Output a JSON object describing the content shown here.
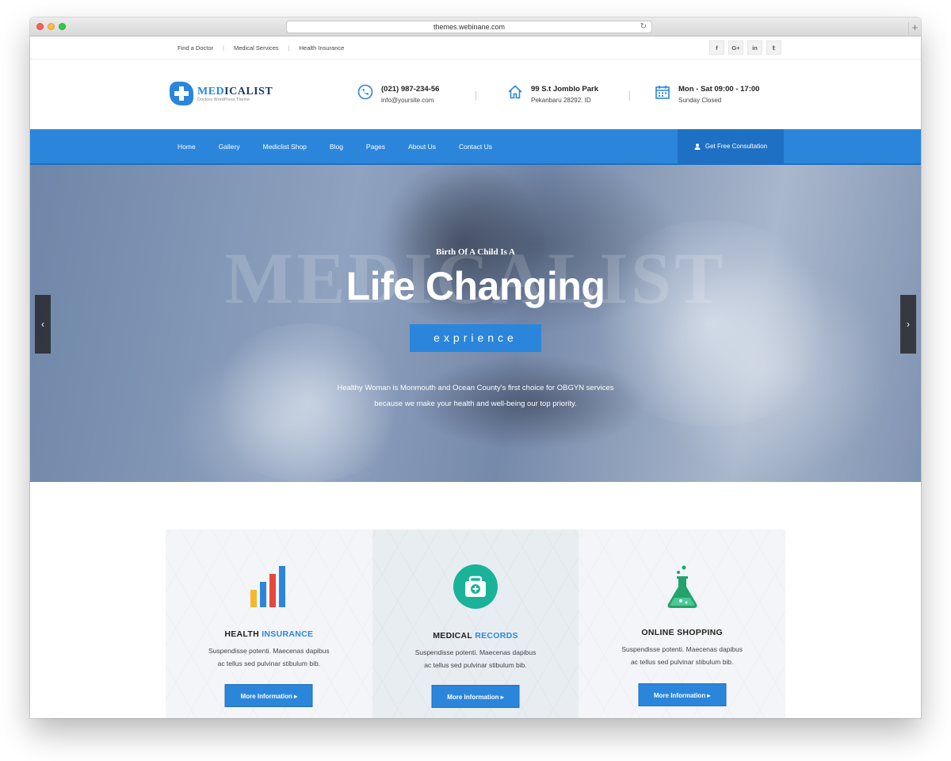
{
  "browser": {
    "url": "themes.webinane.com",
    "reload_icon": "↻",
    "newtab_icon": "+"
  },
  "topbar": {
    "links": [
      "Find a Doctor",
      "Medical Services",
      "Health Insurance"
    ],
    "separator": "|",
    "social": [
      {
        "name": "facebook-icon",
        "glyph": "f"
      },
      {
        "name": "google-plus-icon",
        "glyph": "G+"
      },
      {
        "name": "linkedin-icon",
        "glyph": "in"
      },
      {
        "name": "twitter-icon",
        "glyph": "𝕥"
      }
    ]
  },
  "logo": {
    "name_accent": "MED",
    "name_rest": "ICALIST",
    "tagline": "Doctors WordPress Theme"
  },
  "contacts": {
    "phone": {
      "line1": "(021) 987-234-56",
      "line2": "info@yoursite.com"
    },
    "address": {
      "line1": "99 S.t Jomblo Park",
      "line2": "Pekanbaru 28292. ID"
    },
    "hours": {
      "line1": "Mon - Sat 09:00 - 17:00",
      "line2": "Sunday Closed"
    }
  },
  "nav": {
    "items": [
      "Home",
      "Gallery",
      "Mediclist Shop",
      "Blog",
      "Pages",
      "About Us",
      "Contact Us"
    ],
    "cta": "Get Free Consultation"
  },
  "hero": {
    "watermark": "MEDICALIST",
    "kicker": "Birth Of A Child Is A",
    "title": "Life Changing",
    "tag": "exprience",
    "desc_line1": "Healthy Woman is Monmouth and Ocean County's first choice for OBGYN services",
    "desc_line2": "because we make your health and well-being our top priority.",
    "prev": "‹",
    "next": "›"
  },
  "features": [
    {
      "title_a": "HEALTH ",
      "title_b": "INSURANCE",
      "text1": "Suspendisse potenti. Maecenas dapibus",
      "text2": "ac tellus sed pulvinar stibulum bib.",
      "button": "More Information  ▸",
      "icon": "bar-chart-icon"
    },
    {
      "title_a": "MEDICAL ",
      "title_b": "RECORDS",
      "text1": "Suspendisse potenti. Maecenas dapibus",
      "text2": "ac tellus sed pulvinar stibulum bib.",
      "button": "More Information  ▸",
      "icon": "medical-kit-icon"
    },
    {
      "title_a": "ONLINE SHOPPING",
      "title_b": "",
      "text1": "Suspendisse potenti. Maecenas dapibus",
      "text2": "ac tellus sed pulvinar stibulum bib.",
      "button": "More Information  ▸",
      "icon": "flask-icon"
    }
  ],
  "colors": {
    "primary": "#2b86db",
    "primary_dark": "#1e70c4",
    "bar_yellow": "#f5b82e",
    "bar_red": "#e5483f",
    "bar_blue": "#2b86db",
    "teal": "#1ab39a",
    "green": "#22a36b"
  }
}
